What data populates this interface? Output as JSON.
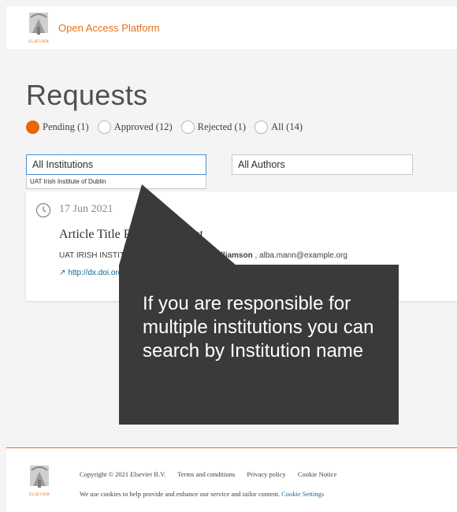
{
  "header": {
    "logo_text": "ELSEVIER",
    "brand": "Open Access Platform"
  },
  "page": {
    "title": "Requests"
  },
  "status_filters": [
    {
      "label": "Pending (1)",
      "selected": true
    },
    {
      "label": "Approved (12)",
      "selected": false
    },
    {
      "label": "Rejected (1)",
      "selected": false
    },
    {
      "label": "All (14)",
      "selected": false
    }
  ],
  "institution_filter": {
    "value": "All Institutions",
    "option": "UAT Irish Institute of Dublin"
  },
  "author_filter": {
    "value": "All Authors"
  },
  "request": {
    "date": "17 Jun 2021",
    "title": "Article Title Regression Test",
    "institution": "UAT IRISH INSTITUTE OF DUBLIN",
    "author_name": "Jane Williamson",
    "author_email": ", alba.mann@example.org",
    "doi": "http://dx.doi.org/10.1016/j.test.2021"
  },
  "tooltip": {
    "text": "If you are responsible for multiple institutions you can search by Institution name"
  },
  "footer": {
    "logo_text": "ELSEVIER",
    "copyright": "Copyright © 2021 Elsevier B.V.",
    "terms": "Terms and conditions",
    "privacy": "Privacy policy",
    "cookie_notice": "Cookie Notice",
    "cookie_text": "We use cookies to help provide and enhance our service and tailor content.",
    "cookie_settings": "Cookie Settings"
  },
  "colors": {
    "accent": "#eb6500",
    "link": "#0c6a9c",
    "tooltip_bg": "#3a3a3a"
  }
}
